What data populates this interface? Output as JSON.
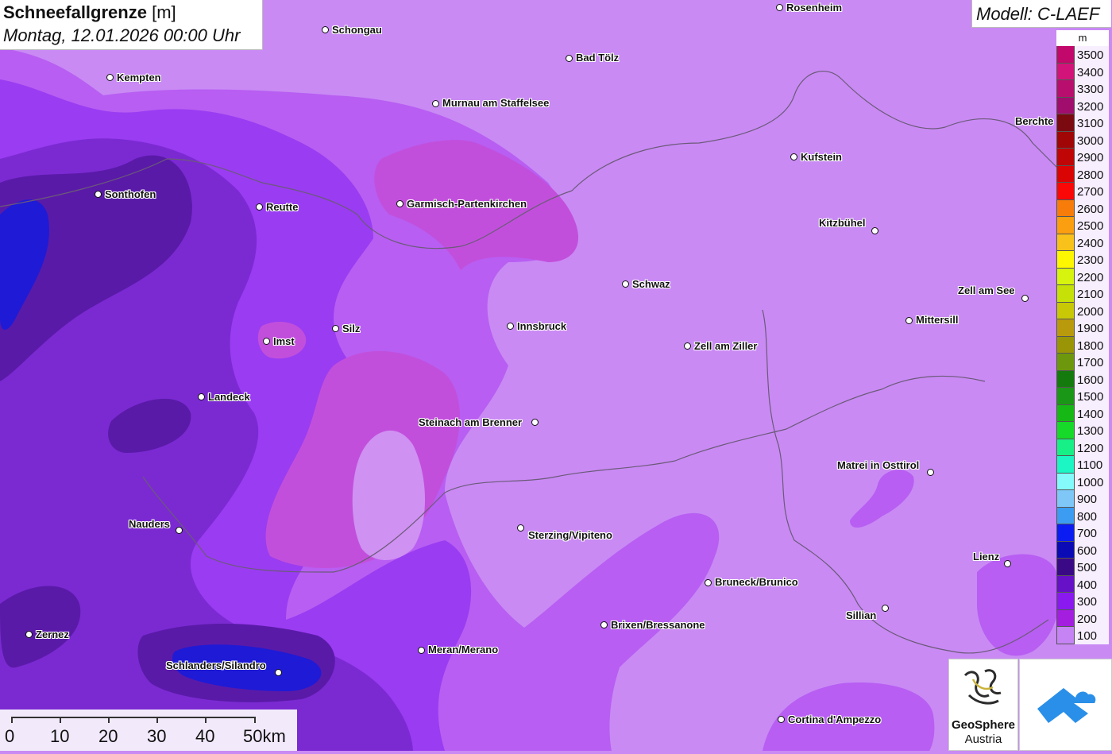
{
  "title": {
    "bold": "Schneefallgrenze",
    "unit": "[m]",
    "datetime": "Montag, 12.01.2026 00:00 Uhr"
  },
  "model": "Modell: C-LAEF",
  "legend": {
    "unit": "m",
    "items": [
      {
        "label": "3500",
        "color": "#c2086a"
      },
      {
        "label": "3400",
        "color": "#d21379"
      },
      {
        "label": "3300",
        "color": "#b80e6e"
      },
      {
        "label": "3200",
        "color": "#a00d6c"
      },
      {
        "label": "3100",
        "color": "#7a0a10"
      },
      {
        "label": "3000",
        "color": "#a00606"
      },
      {
        "label": "2900",
        "color": "#bf0505"
      },
      {
        "label": "2800",
        "color": "#db0404"
      },
      {
        "label": "2700",
        "color": "#fa0707"
      },
      {
        "label": "2600",
        "color": "#f77c0a"
      },
      {
        "label": "2500",
        "color": "#fb9e0f"
      },
      {
        "label": "2400",
        "color": "#f9c21b"
      },
      {
        "label": "2300",
        "color": "#fdf702"
      },
      {
        "label": "2200",
        "color": "#d7f40e"
      },
      {
        "label": "2100",
        "color": "#c6e108"
      },
      {
        "label": "2000",
        "color": "#c8c807"
      },
      {
        "label": "1900",
        "color": "#b99a0c"
      },
      {
        "label": "1800",
        "color": "#9a9507"
      },
      {
        "label": "1700",
        "color": "#6d980d"
      },
      {
        "label": "1600",
        "color": "#157a0d"
      },
      {
        "label": "1500",
        "color": "#1a9716"
      },
      {
        "label": "1400",
        "color": "#16b816"
      },
      {
        "label": "1300",
        "color": "#16d92a"
      },
      {
        "label": "1200",
        "color": "#17f086"
      },
      {
        "label": "1100",
        "color": "#1cf5c4"
      },
      {
        "label": "1000",
        "color": "#84fafb"
      },
      {
        "label": "900",
        "color": "#7ec7f7"
      },
      {
        "label": "800",
        "color": "#3b9cf2"
      },
      {
        "label": "700",
        "color": "#0b1cf2"
      },
      {
        "label": "600",
        "color": "#0b0bb5"
      },
      {
        "label": "500",
        "color": "#3a0a86"
      },
      {
        "label": "400",
        "color": "#6611c8"
      },
      {
        "label": "300",
        "color": "#8a19f0"
      },
      {
        "label": "200",
        "color": "#a41ee0"
      },
      {
        "label": "100",
        "color": "#c583f4"
      }
    ]
  },
  "scale": {
    "labels": [
      "0",
      "10",
      "20",
      "30",
      "40",
      "50km"
    ]
  },
  "logos": {
    "geosphere_line1": "GeoSphere",
    "geosphere_line2": "Austria"
  },
  "cities": [
    {
      "name": "Rosenheim"
    },
    {
      "name": "Schongau"
    },
    {
      "name": "Bad Tölz"
    },
    {
      "name": "Kempten"
    },
    {
      "name": "Murnau am Staffelsee"
    },
    {
      "name": "Berchte"
    },
    {
      "name": "Kufstein"
    },
    {
      "name": "Sonthofen"
    },
    {
      "name": "Reutte"
    },
    {
      "name": "Garmisch-Partenkirchen"
    },
    {
      "name": "Kitzbühel"
    },
    {
      "name": "Schwaz"
    },
    {
      "name": "Zell am See"
    },
    {
      "name": "Mittersill"
    },
    {
      "name": "Innsbruck"
    },
    {
      "name": "Silz"
    },
    {
      "name": "Imst"
    },
    {
      "name": "Zell am Ziller"
    },
    {
      "name": "Landeck"
    },
    {
      "name": "Steinach am Brenner"
    },
    {
      "name": "Matrei in Osttirol"
    },
    {
      "name": "Nauders"
    },
    {
      "name": "Sterzing/Vipiteno"
    },
    {
      "name": "Lienz"
    },
    {
      "name": "Bruneck/Brunico"
    },
    {
      "name": "Sillian"
    },
    {
      "name": "Brixen/Bressanone"
    },
    {
      "name": "Zernez"
    },
    {
      "name": "Meran/Merano"
    },
    {
      "name": "Schlanders/Silandro"
    },
    {
      "name": "Cortina d'Ampezzo"
    }
  ]
}
